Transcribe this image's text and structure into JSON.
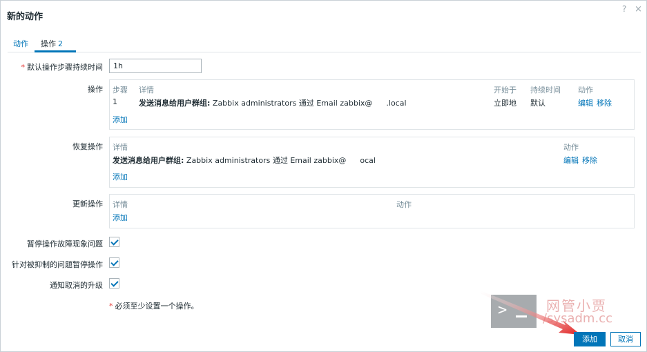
{
  "dialog": {
    "title": "新的动作",
    "help_glyph": "?",
    "close_glyph": "×"
  },
  "tabs": [
    {
      "label": "动作"
    },
    {
      "label": "操作",
      "count": "2"
    }
  ],
  "form": {
    "default_duration_label": "默认操作步骤持续时间",
    "default_duration_value": "1h",
    "operations": {
      "label": "操作",
      "headers": {
        "steps": "步骤",
        "details": "详情",
        "start_in": "开始于",
        "duration": "持续时间",
        "action": "动作"
      },
      "rows": [
        {
          "step": "1",
          "details_bold": "发送消息给用户群组:",
          "details_rest": " Zabbix administrators 通过 Email zabbix@",
          "details_tail": ".local",
          "start_in": "立即地",
          "duration": "默认",
          "edit": "编辑",
          "remove": "移除"
        }
      ],
      "add": "添加"
    },
    "recovery": {
      "label": "恢复操作",
      "headers": {
        "details": "详情",
        "action": "动作"
      },
      "rows": [
        {
          "details_bold": "发送消息给用户群组:",
          "details_rest": " Zabbix administrators 通过 Email zabbix@",
          "details_tail": "ocal",
          "edit": "编辑",
          "remove": "移除"
        }
      ],
      "add": "添加"
    },
    "update": {
      "label": "更新操作",
      "headers": {
        "details": "详情",
        "action": "动作"
      },
      "add": "添加"
    },
    "checkboxes": [
      {
        "label": "暂停操作故障现象问题",
        "checked": true
      },
      {
        "label": "针对被抑制的问题暂停操作",
        "checked": true
      },
      {
        "label": "通知取消的升级",
        "checked": true
      }
    ],
    "required_note": "必须至少设置一个操作。"
  },
  "buttons": {
    "add": "添加",
    "cancel": "取消"
  },
  "watermark": {
    "logo_glyph": ">",
    "text_cn": "网管小贾",
    "text_url": "/sysadm.cc"
  },
  "colors": {
    "accent": "#0275b8",
    "required": "#e33734",
    "muted_header": "#768d99",
    "border": "#dfe4e7",
    "arrow": "#e02020"
  }
}
